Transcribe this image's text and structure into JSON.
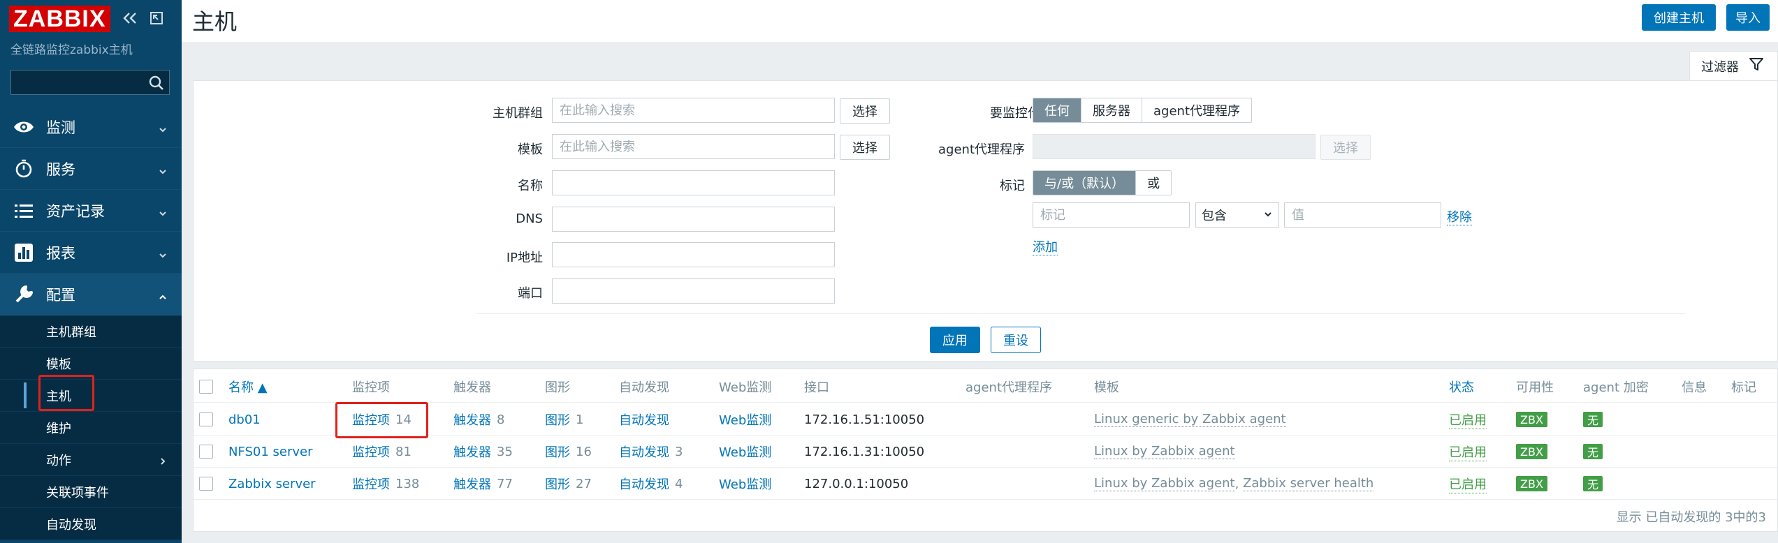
{
  "sidebar": {
    "logo": "ZABBIX",
    "subtitle": "全链路监控zabbix主机",
    "search_placeholder": "",
    "menu": [
      {
        "label": "监测",
        "icon": "eye-icon"
      },
      {
        "label": "服务",
        "icon": "clock-icon"
      },
      {
        "label": "资产记录",
        "icon": "list-icon"
      },
      {
        "label": "报表",
        "icon": "bar-chart-icon"
      },
      {
        "label": "配置",
        "icon": "wrench-icon"
      }
    ],
    "submenu": [
      "主机群组",
      "模板",
      "主机",
      "维护",
      "动作",
      "关联项事件",
      "自动发现"
    ],
    "active_submenu": "主机"
  },
  "header": {
    "title": "主机",
    "create_host": "创建主机",
    "import": "导入"
  },
  "filter": {
    "tab_label": "过滤器",
    "host_groups_label": "主机群组",
    "host_groups_placeholder": "在此输入搜索",
    "templates_label": "模板",
    "templates_placeholder": "在此输入搜索",
    "select_label": "选择",
    "name_label": "名称",
    "dns_label": "DNS",
    "ip_label": "IP地址",
    "port_label": "端口",
    "monitored_by_label": "要监控什么",
    "monitored_by_options": [
      "任何",
      "服务器",
      "agent代理程序"
    ],
    "proxy_label": "agent代理程序",
    "tags_label": "标记",
    "tags_mode_options": [
      "与/或（默认）",
      "或"
    ],
    "tag_placeholder": "标记",
    "tag_operator": "包含",
    "value_placeholder": "值",
    "remove_label": "移除",
    "add_label": "添加",
    "apply_label": "应用",
    "reset_label": "重设"
  },
  "table": {
    "columns": [
      "名称 ▲",
      "监控项",
      "触发器",
      "图形",
      "自动发现",
      "Web监测",
      "接口",
      "agent代理程序",
      "模板",
      "状态",
      "可用性",
      "agent 加密",
      "信息",
      "标记"
    ],
    "rows": [
      {
        "name": "db01",
        "items_label": "监控项",
        "items": "14",
        "triggers_label": "触发器",
        "triggers": "8",
        "graphs_label": "图形",
        "graphs": "1",
        "discovery_label": "自动发现",
        "discovery": "",
        "web": "Web监测",
        "interface": "172.16.1.51:10050",
        "templates": [
          "Linux generic by Zabbix agent"
        ],
        "status": "已启用",
        "availability": "ZBX",
        "encryption": "无"
      },
      {
        "name": "NFS01 server",
        "items_label": "监控项",
        "items": "81",
        "triggers_label": "触发器",
        "triggers": "35",
        "graphs_label": "图形",
        "graphs": "16",
        "discovery_label": "自动发现",
        "discovery": "3",
        "web": "Web监测",
        "interface": "172.16.1.31:10050",
        "templates": [
          "Linux by Zabbix agent"
        ],
        "status": "已启用",
        "availability": "ZBX",
        "encryption": "无"
      },
      {
        "name": "Zabbix server",
        "items_label": "监控项",
        "items": "138",
        "triggers_label": "触发器",
        "triggers": "77",
        "graphs_label": "图形",
        "graphs": "27",
        "discovery_label": "自动发现",
        "discovery": "4",
        "web": "Web监测",
        "interface": "127.0.0.1:10050",
        "templates": [
          "Linux by Zabbix agent",
          "Zabbix server health"
        ],
        "status": "已启用",
        "availability": "ZBX",
        "encryption": "无"
      }
    ],
    "footer": "显示 已自动发现的 3中的3"
  }
}
